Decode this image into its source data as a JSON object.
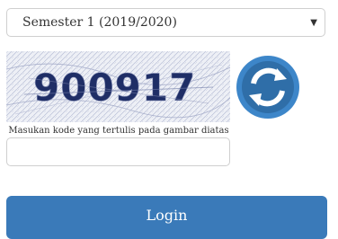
{
  "form": {
    "semester_select": {
      "selected": "Semester 1 (2019/2020)"
    },
    "captcha": {
      "code": "900917",
      "hint": "Masukan kode yang tertulis pada gambar diatas",
      "input_value": "",
      "refresh_icon": "refresh-icon"
    },
    "login_label": "Login"
  },
  "colors": {
    "primary": "#3a7ab9",
    "captcha_text": "#1f2e66",
    "refresh_outer": "#3d86c9",
    "refresh_inner": "#2f6ea8"
  }
}
